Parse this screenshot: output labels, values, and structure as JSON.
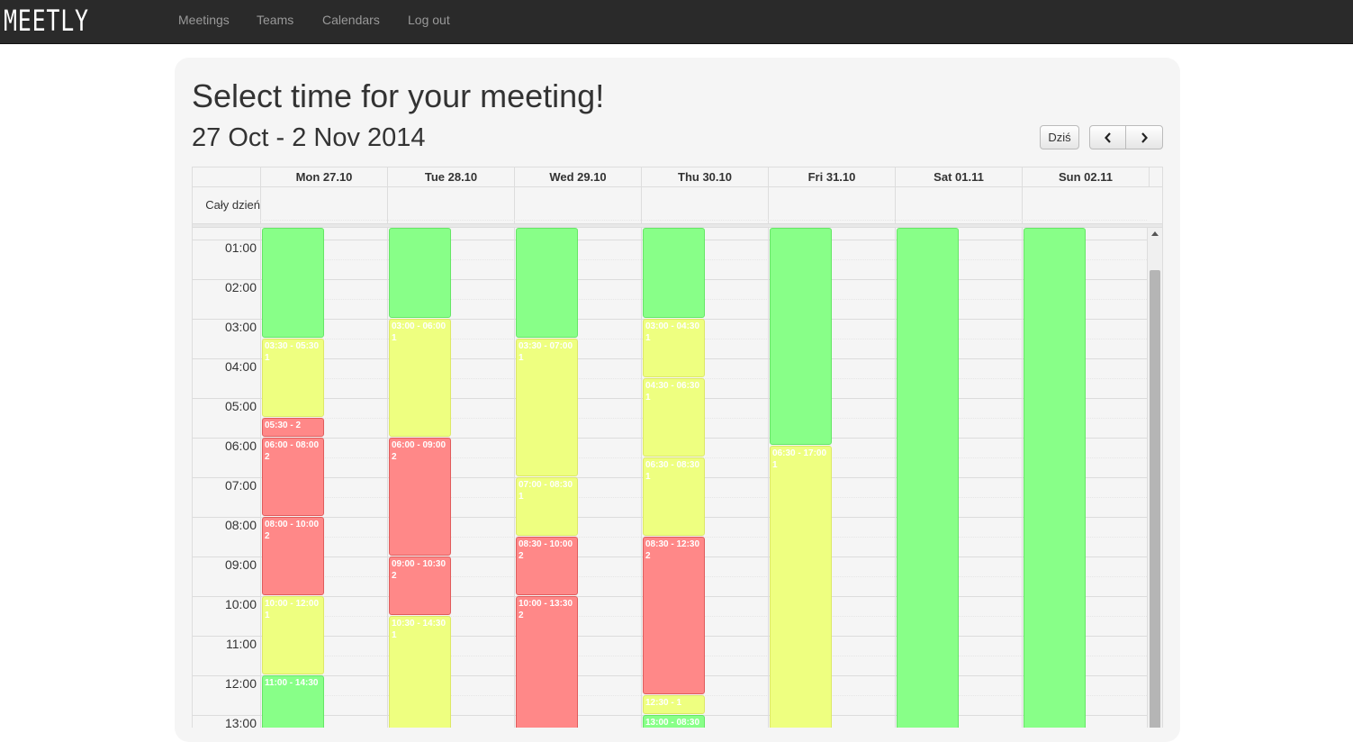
{
  "app": {
    "brand": "MEETLY",
    "nav": [
      "Meetings",
      "Teams",
      "Calendars",
      "Log out"
    ]
  },
  "page": {
    "title": "Select time for your meeting!",
    "week_range": "27 Oct - 2 Nov 2014"
  },
  "toolbar": {
    "today_label": "Dziś",
    "prev_icon": "chevron-left-icon",
    "next_icon": "chevron-right-icon"
  },
  "calendar": {
    "all_day_label": "Cały dzień",
    "days": [
      "Mon 27.10",
      "Tue 28.10",
      "Wed 29.10",
      "Thu 30.10",
      "Fri 31.10",
      "Sat 01.11",
      "Sun 02.11"
    ],
    "hours": [
      "01:00",
      "02:00",
      "03:00",
      "04:00",
      "05:00",
      "06:00",
      "07:00",
      "08:00",
      "09:00",
      "10:00",
      "11:00",
      "12:00",
      "13:00"
    ],
    "availability_colors": {
      "free": "#88ff88",
      "partial": "#eeff80",
      "busy": "#ff8888"
    },
    "events": [
      {
        "day": 0,
        "start": 0.0,
        "end": 3.5,
        "status": "free",
        "time": "",
        "count": ""
      },
      {
        "day": 0,
        "start": 3.5,
        "end": 5.5,
        "status": "partial",
        "time": "03:30 - 05:30",
        "count": "1"
      },
      {
        "day": 0,
        "start": 5.5,
        "end": 6.0,
        "status": "busy",
        "time": "05:30 - 2",
        "count": ""
      },
      {
        "day": 0,
        "start": 6.0,
        "end": 8.0,
        "status": "busy",
        "time": "06:00 - 08:00",
        "count": "2"
      },
      {
        "day": 0,
        "start": 8.0,
        "end": 10.0,
        "status": "busy",
        "time": "08:00 - 10:00",
        "count": "2"
      },
      {
        "day": 0,
        "start": 10.0,
        "end": 12.0,
        "status": "partial",
        "time": "10:00 - 12:00",
        "count": "1"
      },
      {
        "day": 0,
        "start": 12.0,
        "end": 14.5,
        "status": "free",
        "time": "11:00 - 14:30",
        "count": ""
      },
      {
        "day": 1,
        "start": 0.0,
        "end": 3.0,
        "status": "free",
        "time": "",
        "count": ""
      },
      {
        "day": 1,
        "start": 3.0,
        "end": 6.0,
        "status": "partial",
        "time": "03:00 - 06:00",
        "count": "1"
      },
      {
        "day": 1,
        "start": 6.0,
        "end": 9.0,
        "status": "busy",
        "time": "06:00 - 09:00",
        "count": "2"
      },
      {
        "day": 1,
        "start": 9.0,
        "end": 10.5,
        "status": "busy",
        "time": "09:00 - 10:30",
        "count": "2"
      },
      {
        "day": 1,
        "start": 10.5,
        "end": 14.5,
        "status": "partial",
        "time": "10:30 - 14:30",
        "count": "1"
      },
      {
        "day": 2,
        "start": 0.0,
        "end": 3.5,
        "status": "free",
        "time": "",
        "count": ""
      },
      {
        "day": 2,
        "start": 3.5,
        "end": 7.0,
        "status": "partial",
        "time": "03:30 - 07:00",
        "count": "1"
      },
      {
        "day": 2,
        "start": 7.0,
        "end": 8.5,
        "status": "partial",
        "time": "07:00 - 08:30",
        "count": "1"
      },
      {
        "day": 2,
        "start": 8.5,
        "end": 10.0,
        "status": "busy",
        "time": "08:30 - 10:00",
        "count": "2"
      },
      {
        "day": 2,
        "start": 10.0,
        "end": 14.5,
        "status": "busy",
        "time": "10:00 - 13:30",
        "count": "2"
      },
      {
        "day": 3,
        "start": 0.0,
        "end": 3.0,
        "status": "free",
        "time": "",
        "count": ""
      },
      {
        "day": 3,
        "start": 3.0,
        "end": 4.5,
        "status": "partial",
        "time": "03:00 - 04:30",
        "count": "1"
      },
      {
        "day": 3,
        "start": 4.5,
        "end": 6.5,
        "status": "partial",
        "time": "04:30 - 06:30",
        "count": "1"
      },
      {
        "day": 3,
        "start": 6.5,
        "end": 8.5,
        "status": "partial",
        "time": "06:30 - 08:30",
        "count": "1"
      },
      {
        "day": 3,
        "start": 8.5,
        "end": 12.5,
        "status": "busy",
        "time": "08:30 - 12:30",
        "count": "2"
      },
      {
        "day": 3,
        "start": 12.5,
        "end": 13.0,
        "status": "partial",
        "time": "12:30 - 1",
        "count": ""
      },
      {
        "day": 3,
        "start": 13.0,
        "end": 14.5,
        "status": "free",
        "time": "13:00 - 08:30",
        "count": ""
      },
      {
        "day": 4,
        "start": 0.0,
        "end": 6.2,
        "status": "free",
        "time": "",
        "count": ""
      },
      {
        "day": 4,
        "start": 6.2,
        "end": 14.5,
        "status": "partial",
        "time": "06:30 - 17:00",
        "count": "1"
      },
      {
        "day": 5,
        "start": 0.0,
        "end": 14.5,
        "status": "free",
        "time": "",
        "count": ""
      },
      {
        "day": 6,
        "start": 0.0,
        "end": 14.5,
        "status": "free",
        "time": "",
        "count": ""
      }
    ]
  }
}
